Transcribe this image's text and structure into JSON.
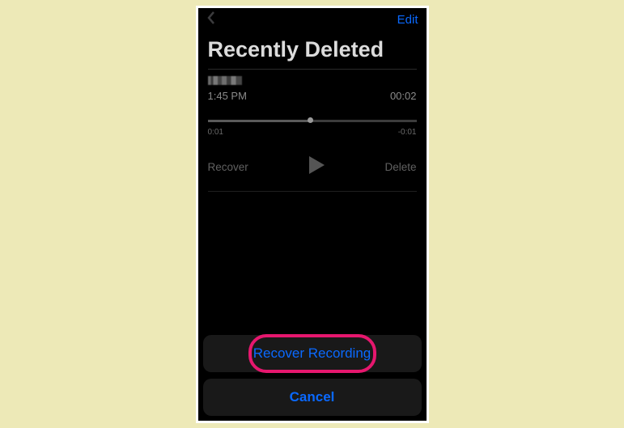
{
  "nav": {
    "edit": "Edit"
  },
  "title": "Recently Deleted",
  "recording": {
    "time": "1:45 PM",
    "duration": "00:02",
    "elapsed": "0:01",
    "remaining": "-0:01"
  },
  "controls": {
    "recover": "Recover",
    "delete": "Delete"
  },
  "sheet": {
    "recover_recording": "Recover Recording",
    "cancel": "Cancel"
  }
}
